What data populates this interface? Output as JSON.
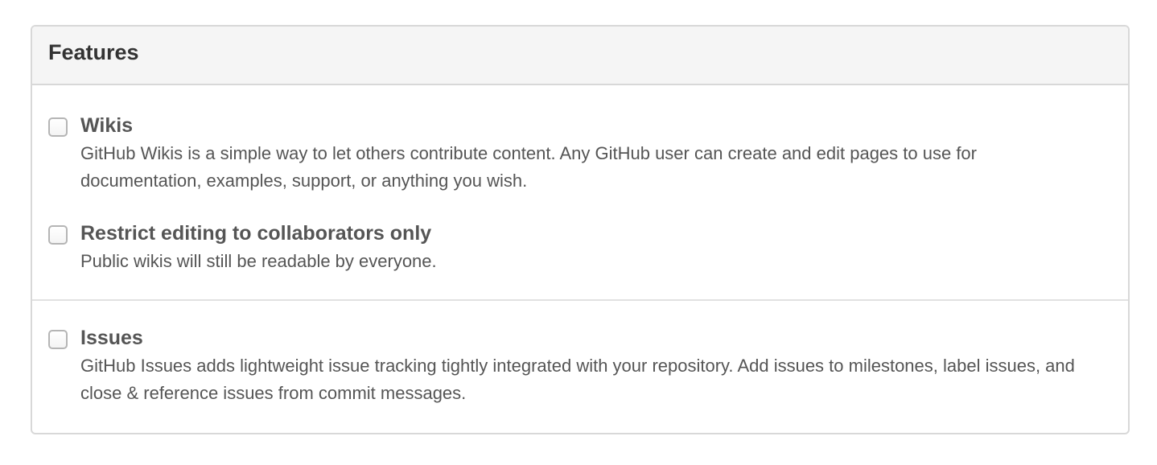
{
  "features": {
    "title": "Features",
    "options": [
      {
        "label": "Wikis",
        "checked": false,
        "description": "GitHub Wikis is a simple way to let others contribute content. Any GitHub user can create and edit pages to use for documentation, examples, support, or anything you wish."
      },
      {
        "label": "Restrict editing to collaborators only",
        "checked": false,
        "description": "Public wikis will still be readable by everyone."
      },
      {
        "label": "Issues",
        "checked": false,
        "description": "GitHub Issues adds lightweight issue tracking tightly integrated with your repository. Add issues to milestones, label issues, and close & reference issues from commit messages."
      }
    ]
  },
  "colors": {
    "header_background": "#f5f5f5",
    "border": "#d8d8d8",
    "text": "#555555",
    "title_text": "#333333"
  }
}
